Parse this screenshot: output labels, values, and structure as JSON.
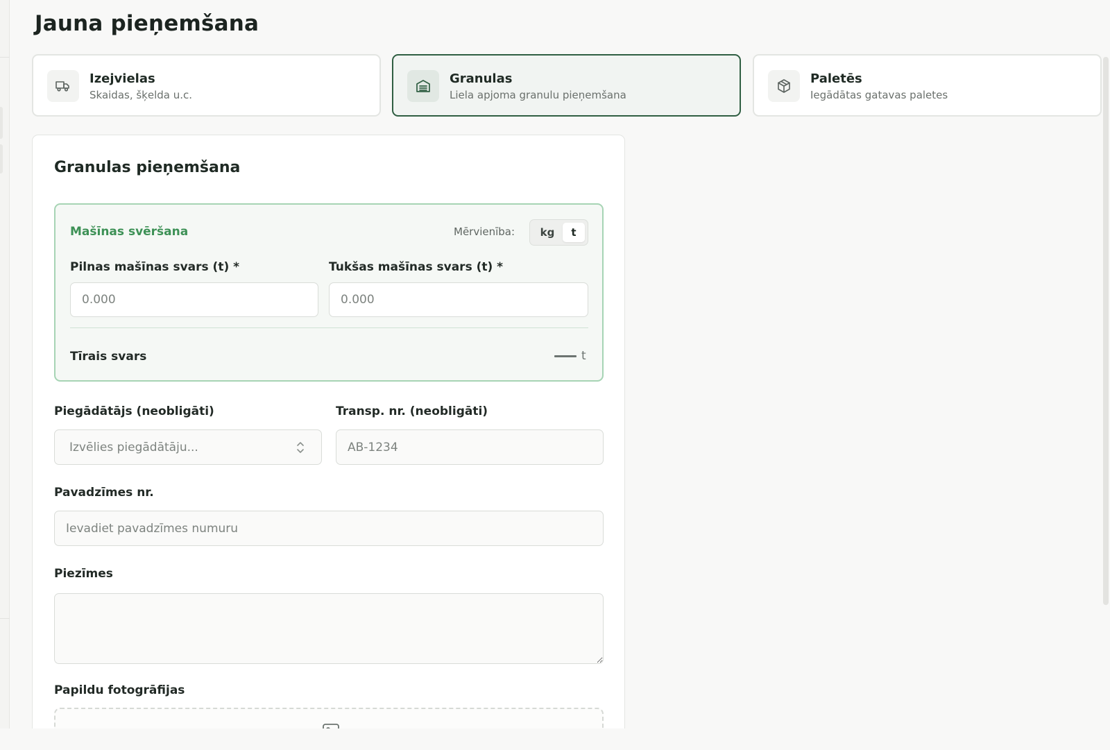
{
  "page": {
    "title": "Jauna pieņemšana"
  },
  "types": [
    {
      "title": "Izejvielas",
      "subtitle": "Skaidas, šķelda u.c.",
      "icon": "truck-icon",
      "selected": false
    },
    {
      "title": "Granulas",
      "subtitle": "Liela apjoma granulu pieņemšana",
      "icon": "warehouse-icon",
      "selected": true
    },
    {
      "title": "Paletēs",
      "subtitle": "Iegādātas gatavas paletes",
      "icon": "package-icon",
      "selected": false
    }
  ],
  "form": {
    "title": "Granulas pieņemšana",
    "weighing": {
      "title": "Mašīnas svēršana",
      "unit_label": "Mērvienība:",
      "units": [
        "kg",
        "t"
      ],
      "selected_unit": "t",
      "full_label": "Pilnas mašīnas svars (t) *",
      "full_placeholder": "0.000",
      "empty_label": "Tukšas mašīnas svars (t) *",
      "empty_placeholder": "0.000",
      "net_label": "Tīrais svars",
      "net_value": "—",
      "net_unit": "t"
    },
    "supplier_label": "Piegādātājs (neobligāti)",
    "supplier_placeholder": "Izvēlies piegādātāju...",
    "transport_label": "Transp. nr. (neobligāti)",
    "transport_placeholder": "AB-1234",
    "invoice_label": "Pavadzīmes nr.",
    "invoice_placeholder": "Ievadiet pavadzīmes numuru",
    "notes_label": "Piezīmes",
    "notes_value": "",
    "photos_label": "Papildu fotogrāfijas"
  },
  "colors": {
    "accent_dark": "#2f5e42",
    "accent_green": "#3d9156",
    "weigh_border": "#a6d4b4"
  }
}
